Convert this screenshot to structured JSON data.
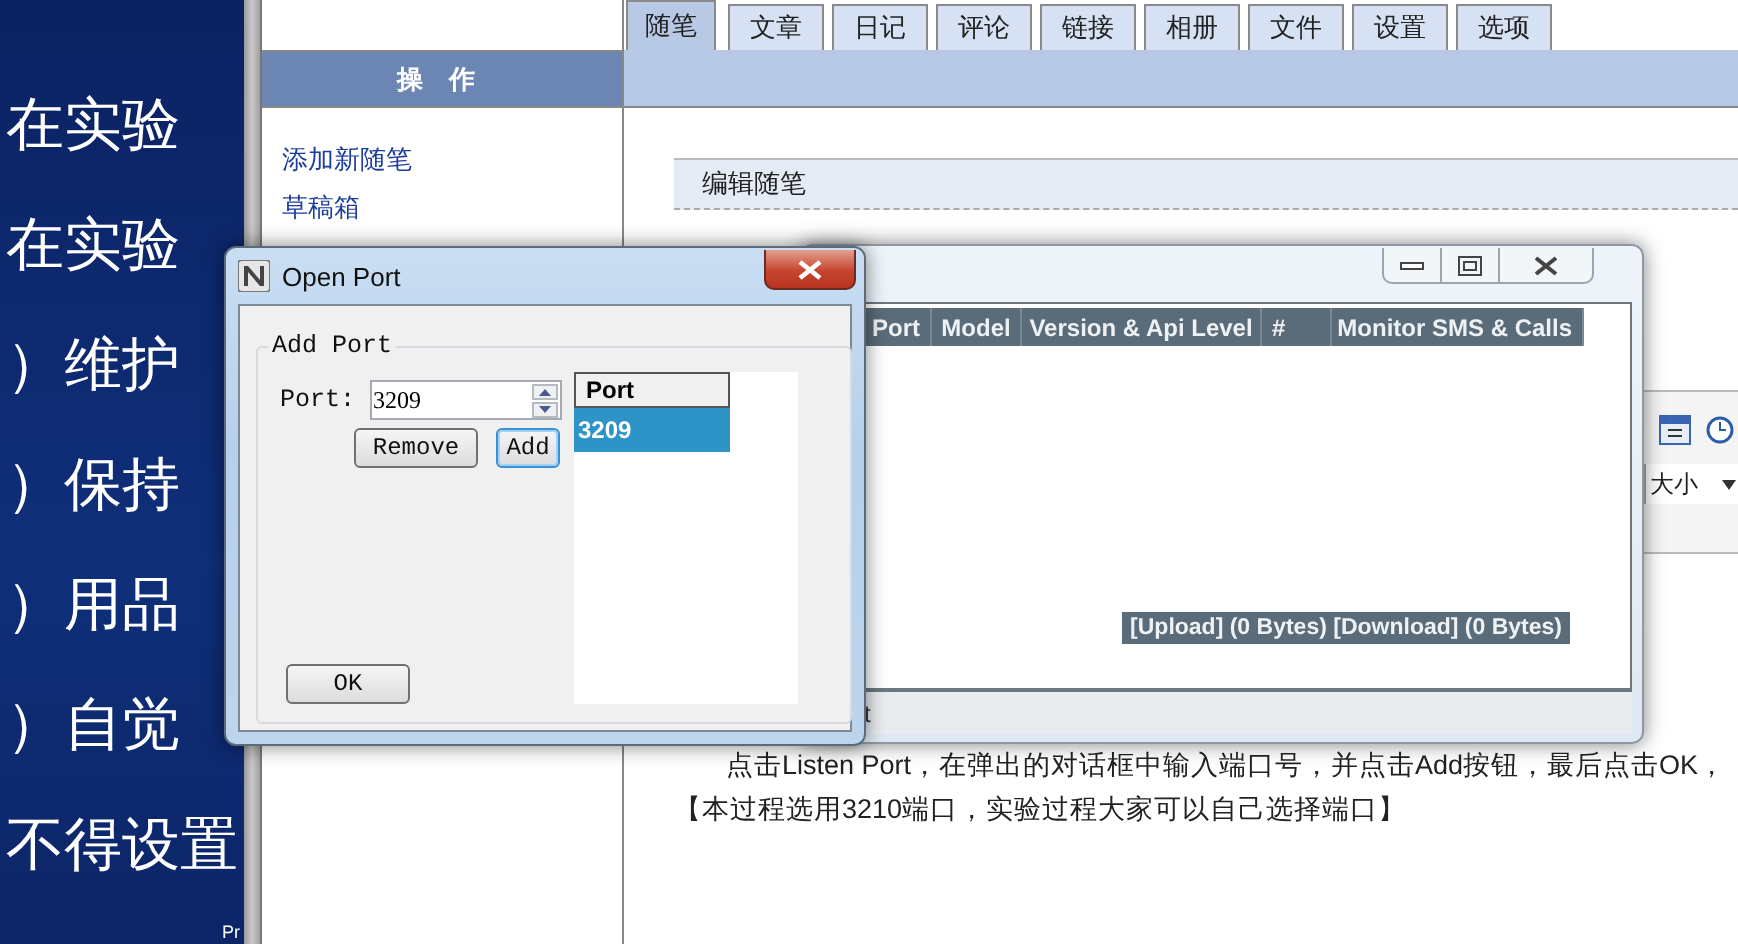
{
  "slide": {
    "lines": [
      "在实验",
      "在实验",
      "）维护",
      "）保持",
      "）用品",
      "）自觉",
      "不得设置"
    ],
    "corner_text": "Pr"
  },
  "blog": {
    "sidebar": {
      "header": "操　作",
      "links": [
        "添加新随笔",
        "草稿箱"
      ]
    },
    "tabs": [
      {
        "label": "随笔",
        "selected": true
      },
      {
        "label": "文章",
        "selected": false
      },
      {
        "label": "日记",
        "selected": false
      },
      {
        "label": "评论",
        "selected": false
      },
      {
        "label": "链接",
        "selected": false
      },
      {
        "label": "相册",
        "selected": false
      },
      {
        "label": "文件",
        "selected": false
      },
      {
        "label": "设置",
        "selected": false
      },
      {
        "label": "选项",
        "selected": false
      }
    ],
    "section_title": "编辑随笔",
    "font_size_select": "大小",
    "body": [
      "点击Listen Port，在弹出的对话框中输入端口号，并点击Add按钮，最后点击OK，",
      "【本过程选用3210端口，实验过程大家可以自己选择端口】"
    ]
  },
  "monitor_window": {
    "columns": [
      "Port",
      "Model",
      "Version & Api Level",
      "#",
      "Monitor SMS & Calls"
    ],
    "transfer": "[Upload] (0 Bytes) [Download] (0 Bytes)",
    "status": "t"
  },
  "dialog": {
    "title": "Open Port",
    "group": "Add Port",
    "port_label": "Port:",
    "port_value": "3209",
    "remove": "Remove",
    "add": "Add",
    "ok": "OK",
    "list": {
      "header": "Port",
      "rows": [
        {
          "text": "3209",
          "selected": true
        }
      ]
    }
  }
}
